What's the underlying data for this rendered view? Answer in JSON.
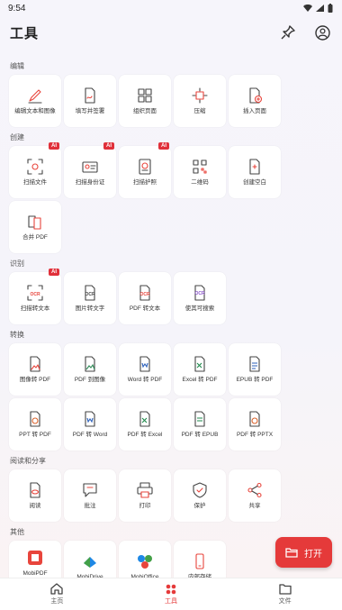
{
  "status": {
    "time": "9:54"
  },
  "header": {
    "title": "工具"
  },
  "sections": [
    {
      "title": "编辑",
      "items": [
        {
          "label": "编辑文本和图像",
          "icon": "edit-text-icon",
          "ai": false
        },
        {
          "label": "填写并签署",
          "icon": "fill-sign-icon",
          "ai": false
        },
        {
          "label": "组织页面",
          "icon": "organize-pages-icon",
          "ai": false
        },
        {
          "label": "压缩",
          "icon": "compress-icon",
          "ai": false
        },
        {
          "label": "插入页面",
          "icon": "insert-page-icon",
          "ai": false
        }
      ]
    },
    {
      "title": "创建",
      "items": [
        {
          "label": "扫描文件",
          "icon": "scan-file-icon",
          "ai": true
        },
        {
          "label": "扫描身份证",
          "icon": "scan-id-icon",
          "ai": true
        },
        {
          "label": "扫描护照",
          "icon": "scan-passport-icon",
          "ai": true
        },
        {
          "label": "二维码",
          "icon": "qr-code-icon",
          "ai": false
        },
        {
          "label": "创建空白",
          "icon": "create-blank-icon",
          "ai": false
        },
        {
          "label": "合并 PDF",
          "icon": "merge-pdf-icon",
          "ai": false
        }
      ]
    },
    {
      "title": "识别",
      "items": [
        {
          "label": "扫描转文本",
          "icon": "scan-to-text-icon",
          "ai": true
        },
        {
          "label": "图片转文字",
          "icon": "image-to-text-icon",
          "ai": false
        },
        {
          "label": "PDF 转文本",
          "icon": "pdf-to-text-icon",
          "ai": false
        },
        {
          "label": "使其可搜索",
          "icon": "make-searchable-icon",
          "ai": false
        }
      ]
    },
    {
      "title": "转换",
      "items": [
        {
          "label": "图像转 PDF",
          "icon": "image-to-pdf-icon",
          "ai": false
        },
        {
          "label": "PDF 到图像",
          "icon": "pdf-to-image-icon",
          "ai": false
        },
        {
          "label": "Word 转 PDF",
          "icon": "word-to-pdf-icon",
          "ai": false
        },
        {
          "label": "Excel 转 PDF",
          "icon": "excel-to-pdf-icon",
          "ai": false
        },
        {
          "label": "EPUB 转 PDF",
          "icon": "epub-to-pdf-icon",
          "ai": false
        },
        {
          "label": "PPT 转 PDF",
          "icon": "ppt-to-pdf-icon",
          "ai": false
        },
        {
          "label": "PDF 转 Word",
          "icon": "pdf-to-word-icon",
          "ai": false
        },
        {
          "label": "PDF 转 Excel",
          "icon": "pdf-to-excel-icon",
          "ai": false
        },
        {
          "label": "PDF 转 EPUB",
          "icon": "pdf-to-epub-icon",
          "ai": false
        },
        {
          "label": "PDF 转 PPTX",
          "icon": "pdf-to-pptx-icon",
          "ai": false
        }
      ]
    },
    {
      "title": "阅读和分享",
      "items": [
        {
          "label": "阅读",
          "icon": "read-icon",
          "ai": false
        },
        {
          "label": "批注",
          "icon": "annotate-icon",
          "ai": false
        },
        {
          "label": "打印",
          "icon": "print-icon",
          "ai": false
        },
        {
          "label": "保护",
          "icon": "protect-icon",
          "ai": false
        },
        {
          "label": "共享",
          "icon": "share-icon",
          "ai": false
        }
      ]
    },
    {
      "title": "其他",
      "items": [
        {
          "label": "MobiPDF Windows",
          "icon": "mobipdf-windows-icon",
          "ai": false
        },
        {
          "label": "MobiDrive",
          "icon": "mobidrive-icon",
          "ai": false
        },
        {
          "label": "MobiOffice",
          "icon": "mobioffice-icon",
          "ai": false
        },
        {
          "label": "内部存储",
          "icon": "internal-storage-icon",
          "ai": false
        }
      ]
    }
  ],
  "ai_badge": "AI",
  "fab": {
    "label": "打开"
  },
  "nav": [
    {
      "label": "主页",
      "icon": "home-icon"
    },
    {
      "label": "工具",
      "icon": "tools-icon"
    },
    {
      "label": "文件",
      "icon": "folder-icon"
    }
  ],
  "colors": {
    "accent": "#e53a3a",
    "icon_red": "#e8453c"
  }
}
